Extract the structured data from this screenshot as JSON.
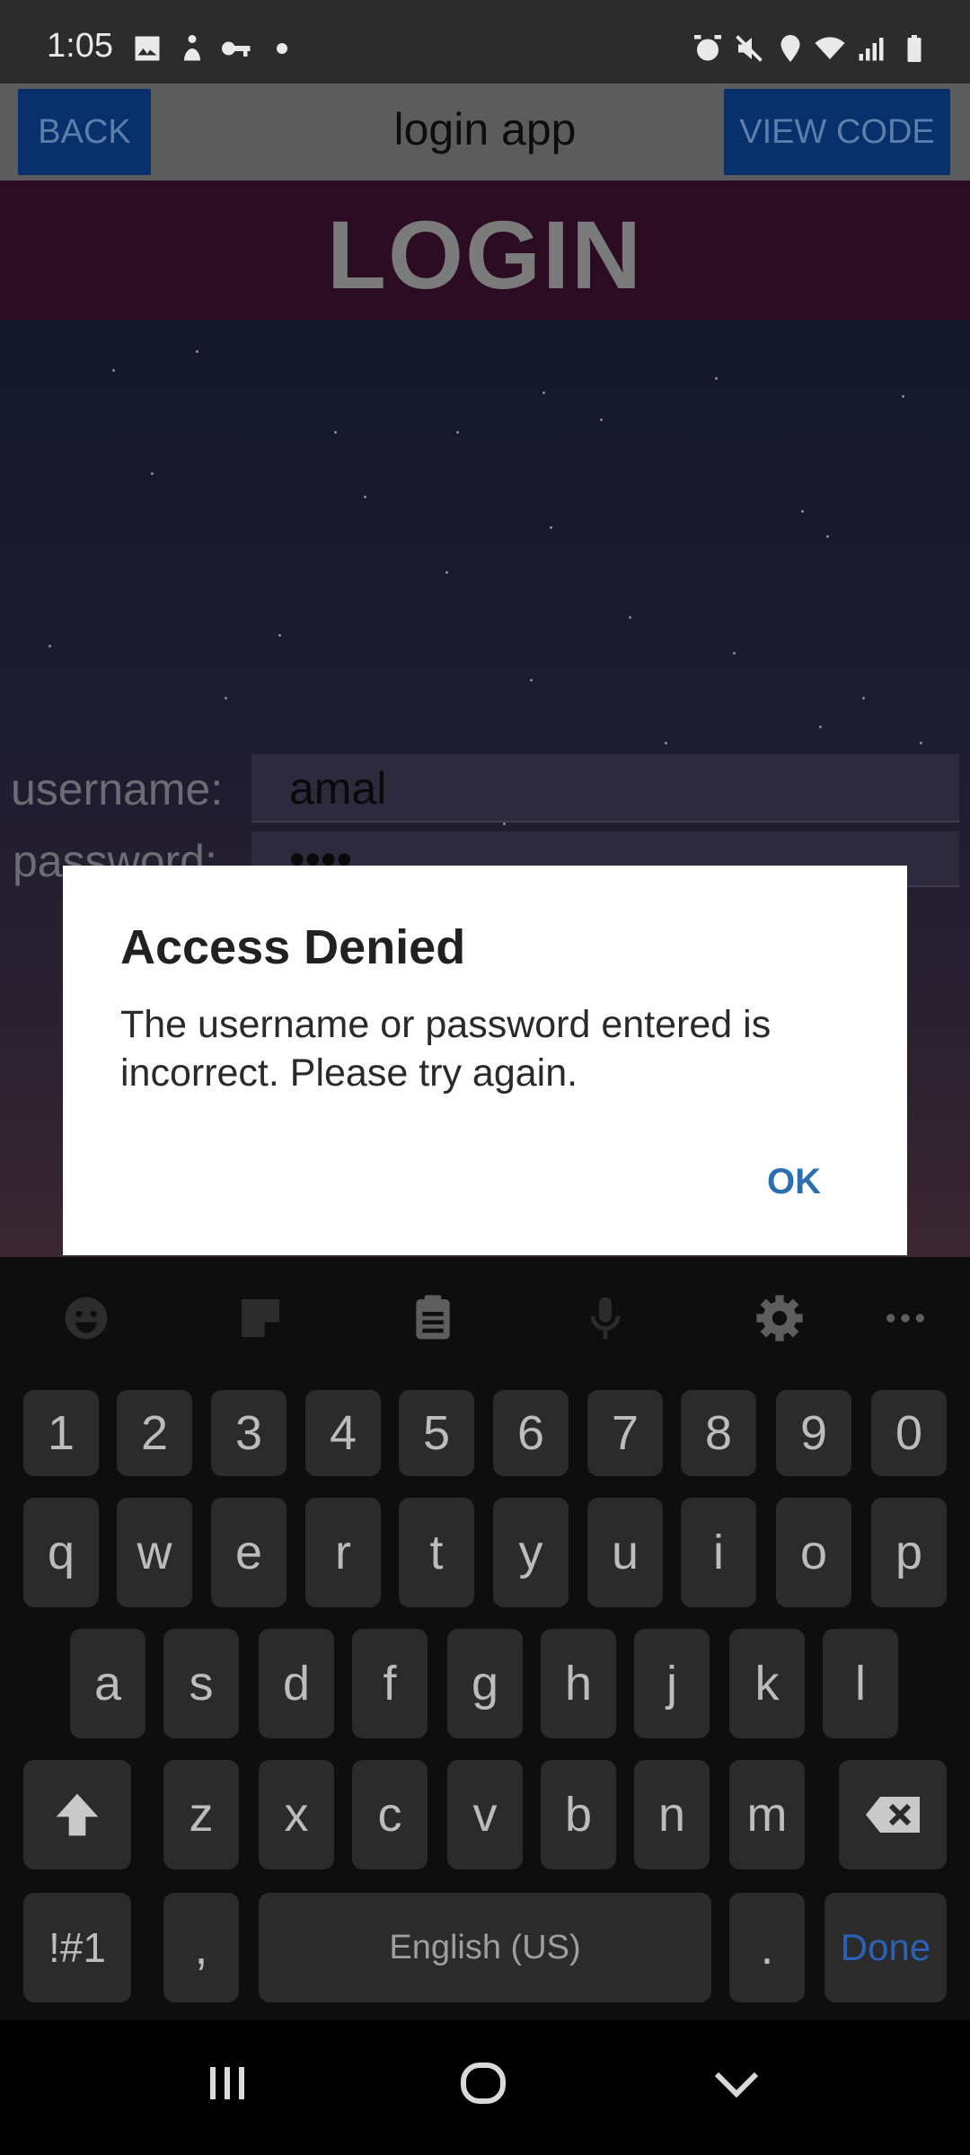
{
  "status_bar": {
    "time": "1:05",
    "left_icons": [
      "image-icon",
      "accessibility-icon",
      "key-icon",
      "dot-icon"
    ],
    "right_icons": [
      "alarm-icon",
      "mute-icon",
      "location-icon",
      "wifi-icon",
      "signal-icon",
      "battery-icon"
    ]
  },
  "header": {
    "back_label": "BACK",
    "title": "login app",
    "view_code_label": "VIEW CODE"
  },
  "login": {
    "heading": "LOGIN",
    "username_label": "username:",
    "username_value": "amal",
    "password_label": "password:",
    "password_value": "••••"
  },
  "dialog": {
    "title": "Access Denied",
    "message": "The username or password entered is incorrect. Please try again.",
    "ok_label": "OK"
  },
  "keyboard": {
    "toolbar": [
      "emoji-icon",
      "sticker-icon",
      "clipboard-icon",
      "microphone-icon",
      "settings-icon",
      "more-icon"
    ],
    "row_numbers": [
      "1",
      "2",
      "3",
      "4",
      "5",
      "6",
      "7",
      "8",
      "9",
      "0"
    ],
    "row_1": [
      "q",
      "w",
      "e",
      "r",
      "t",
      "y",
      "u",
      "i",
      "o",
      "p"
    ],
    "row_2": [
      "a",
      "s",
      "d",
      "f",
      "g",
      "h",
      "j",
      "k",
      "l"
    ],
    "row_3": [
      "z",
      "x",
      "c",
      "v",
      "b",
      "n",
      "m"
    ],
    "symbols_label": "!#1",
    "comma_label": ",",
    "space_label": "English (US)",
    "period_label": ".",
    "done_label": "Done",
    "done_color": "#2b62b8"
  },
  "nav_bar": {
    "icons": [
      "recents-icon",
      "home-icon",
      "back-nav-icon"
    ]
  }
}
